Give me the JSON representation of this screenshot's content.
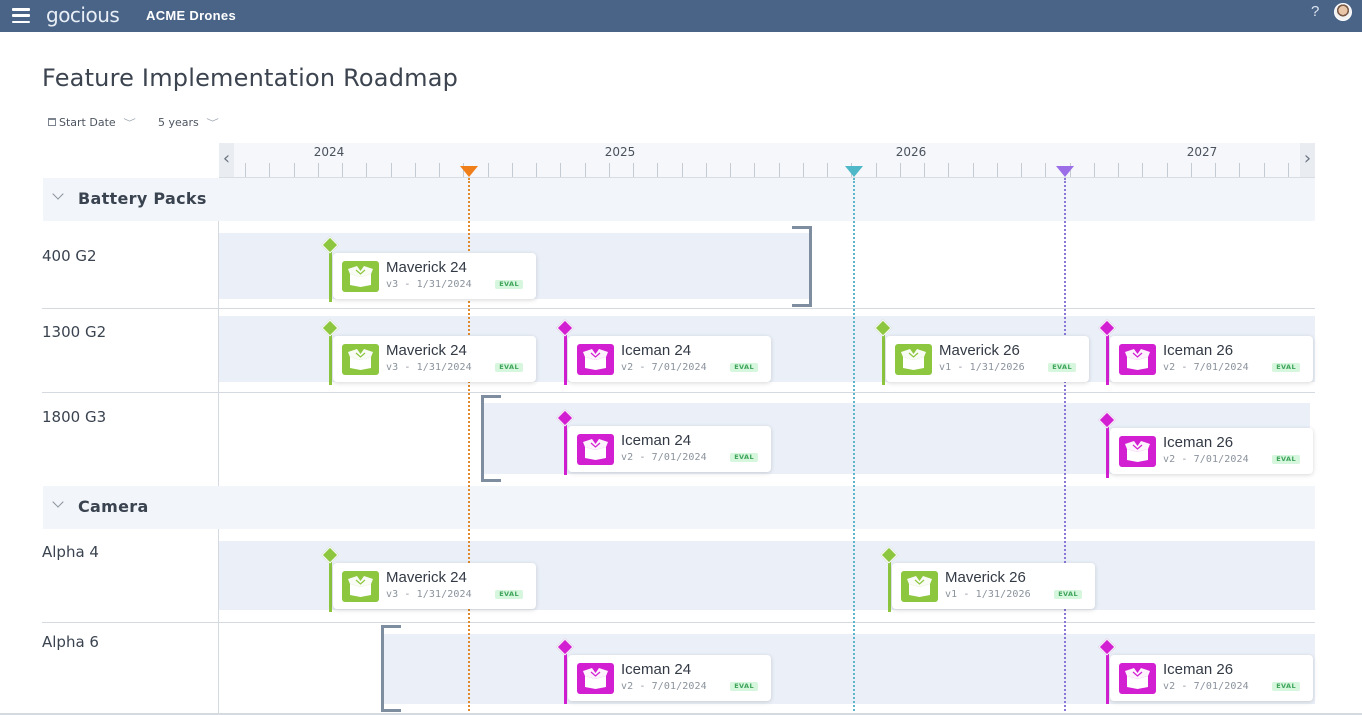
{
  "app": {
    "logo_text": "gocious",
    "company": "ACME Drones",
    "help_label": "?"
  },
  "page": {
    "title": "Feature Implementation Roadmap"
  },
  "filters": {
    "start_date_label": "Start Date",
    "range_label": "5 years"
  },
  "timeline": {
    "prev_label": "‹",
    "next_label": "›",
    "years": [
      "2024",
      "2025",
      "2026",
      "2027"
    ],
    "markers": [
      {
        "name": "orange-marker",
        "color": "#f07f1a",
        "line_color": "#e08a2c"
      },
      {
        "name": "teal-marker",
        "color": "#4fb8c8",
        "line_color": "#5ab6c8"
      },
      {
        "name": "purple-marker",
        "color": "#9b6ee8",
        "line_color": "#8a77d6"
      }
    ]
  },
  "colors": {
    "maverick": "#8dc63f",
    "iceman": "#d21fd2",
    "badge_bg": "#d6f6dd",
    "badge_text": "#3ea45a",
    "header_bg": "#4a6488"
  },
  "groups": [
    {
      "label": "Battery Packs",
      "rows": [
        {
          "label": "400 G2",
          "items": [
            {
              "title": "Maverick 24",
              "subtitle": "v3 - 1/31/2024",
              "badge": "EVAL",
              "type": "maverick"
            }
          ]
        },
        {
          "label": "1300 G2",
          "items": [
            {
              "title": "Maverick 24",
              "subtitle": "v3 - 1/31/2024",
              "badge": "EVAL",
              "type": "maverick"
            },
            {
              "title": "Iceman 24",
              "subtitle": "v2 - 7/01/2024",
              "badge": "EVAL",
              "type": "iceman"
            },
            {
              "title": "Maverick 26",
              "subtitle": "v1 - 1/31/2026",
              "badge": "EVAL",
              "type": "maverick"
            },
            {
              "title": "Iceman 26",
              "subtitle": "v2 - 7/01/2024",
              "badge": "EVAL",
              "type": "iceman"
            }
          ]
        },
        {
          "label": "1800 G3",
          "items": [
            {
              "title": "Iceman 24",
              "subtitle": "v2 - 7/01/2024",
              "badge": "EVAL",
              "type": "iceman"
            },
            {
              "title": "Iceman 26",
              "subtitle": "v2 - 7/01/2024",
              "badge": "EVAL",
              "type": "iceman"
            }
          ]
        }
      ]
    },
    {
      "label": "Camera",
      "rows": [
        {
          "label": "Alpha 4",
          "items": [
            {
              "title": "Maverick 24",
              "subtitle": "v3 - 1/31/2024",
              "badge": "EVAL",
              "type": "maverick"
            },
            {
              "title": "Maverick 26",
              "subtitle": "v1 - 1/31/2026",
              "badge": "EVAL",
              "type": "maverick"
            }
          ]
        },
        {
          "label": "Alpha 6",
          "items": [
            {
              "title": "Iceman 24",
              "subtitle": "v2 - 7/01/2024",
              "badge": "EVAL",
              "type": "iceman"
            },
            {
              "title": "Iceman 26",
              "subtitle": "v2 - 7/01/2024",
              "badge": "EVAL",
              "type": "iceman"
            }
          ]
        }
      ]
    }
  ]
}
